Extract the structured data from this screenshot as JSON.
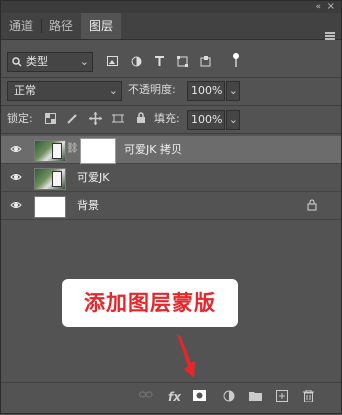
{
  "panel": {
    "tabs": [
      {
        "label": "通道"
      },
      {
        "label": "路径"
      },
      {
        "label": "图层",
        "active": true
      }
    ],
    "collapse_glyph": "«",
    "close_glyph": "×"
  },
  "filter": {
    "kind_label": "类型",
    "search_icon": "search-icon",
    "icons": [
      "image-filter-icon",
      "adjustment-filter-icon",
      "type-filter-icon",
      "shape-filter-icon",
      "smart-object-filter-icon"
    ]
  },
  "blend": {
    "mode": "正常",
    "opacity_label": "不透明度:",
    "opacity_value": "100%",
    "lock_label": "锁定:",
    "fill_label": "填充:",
    "fill_value": "100%"
  },
  "layers": [
    {
      "name": "可爱JK 拷贝",
      "selected": true,
      "has_mask": true,
      "visible": true
    },
    {
      "name": "可爱JK",
      "selected": false,
      "has_mask": false,
      "visible": true
    },
    {
      "name": "背景",
      "selected": false,
      "locked": true,
      "visible": true
    }
  ],
  "callout": {
    "text": "添加图层蒙版"
  },
  "bottom_bar": {
    "icons": [
      "link-layers-icon",
      "fx-icon",
      "add-mask-icon",
      "adjustment-layer-icon",
      "new-group-icon",
      "new-layer-icon",
      "trash-icon"
    ],
    "fx_label": "fx"
  },
  "colors": {
    "accent": "#e8262a",
    "panel_bg": "#535353",
    "selected_row": "#6c6c6c"
  }
}
